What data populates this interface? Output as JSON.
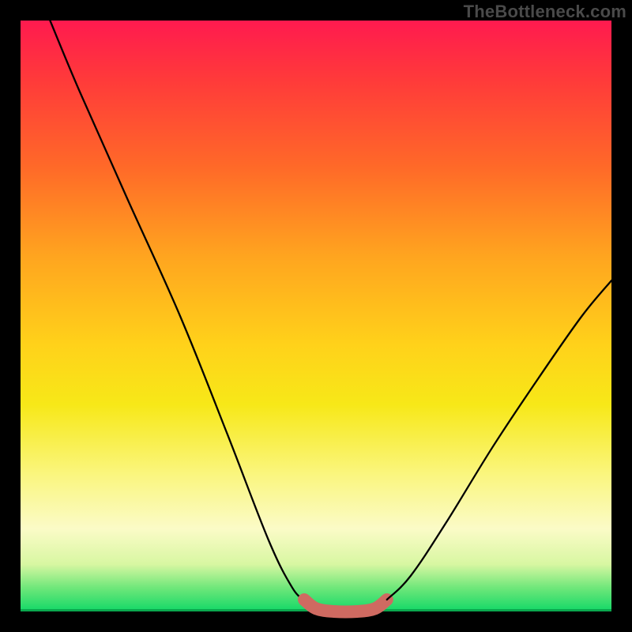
{
  "watermark": "TheBottleneck.com",
  "chart_data": {
    "type": "line",
    "title": "",
    "xlabel": "",
    "ylabel": "",
    "xlim": [
      0,
      100
    ],
    "ylim": [
      0,
      100
    ],
    "gradient_stops": [
      {
        "pos": 0,
        "color": "#ff1a4f"
      },
      {
        "pos": 10,
        "color": "#ff3a3a"
      },
      {
        "pos": 25,
        "color": "#ff6a28"
      },
      {
        "pos": 40,
        "color": "#ffa51f"
      },
      {
        "pos": 55,
        "color": "#ffd21a"
      },
      {
        "pos": 65,
        "color": "#f7e818"
      },
      {
        "pos": 77,
        "color": "#faf680"
      },
      {
        "pos": 86,
        "color": "#fbfbc7"
      },
      {
        "pos": 92,
        "color": "#d8f7a2"
      },
      {
        "pos": 96,
        "color": "#6fe77a"
      },
      {
        "pos": 100,
        "color": "#12d867"
      }
    ],
    "series": [
      {
        "name": "left_curve",
        "stroke": "#000000",
        "x": [
          5,
          10,
          18,
          27,
          35,
          42,
          46,
          48
        ],
        "y": [
          100,
          88,
          70,
          50,
          30,
          12,
          4,
          2
        ]
      },
      {
        "name": "valley_highlight",
        "stroke": "#cf6a61",
        "x": [
          48,
          50,
          53,
          57,
          60,
          62
        ],
        "y": [
          2,
          0.5,
          0,
          0,
          0.5,
          2
        ]
      },
      {
        "name": "right_curve",
        "stroke": "#000000",
        "x": [
          62,
          66,
          72,
          80,
          88,
          95,
          100
        ],
        "y": [
          2,
          6,
          15,
          28,
          40,
          50,
          56
        ]
      }
    ]
  }
}
